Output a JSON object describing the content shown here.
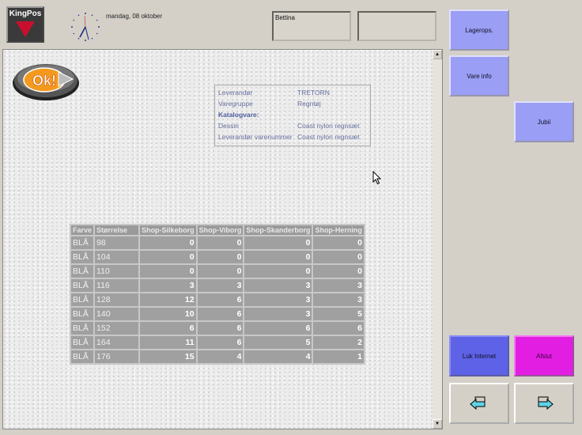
{
  "header": {
    "logo_text": "KingPos",
    "date": "mandag, 08 oktober",
    "user": "Bettina"
  },
  "info": {
    "rows": [
      {
        "key": "Leverandør",
        "value": "TRETORN"
      },
      {
        "key": "Varegruppe",
        "value": "Regntøj"
      },
      {
        "key": "Katalogvare:",
        "value": ""
      },
      {
        "key": "Dessin",
        "value": "Coast nylon regnsæt"
      },
      {
        "key": "Leverandør varenummer",
        "value": "Coast nylon regnsæt"
      }
    ]
  },
  "stock": {
    "headers": [
      "Farve",
      "Størrelse",
      "Shop-Silkeborg",
      "Shop-Viborg",
      "Shop-Skanderborg",
      "Shop-Herning"
    ],
    "rows": [
      [
        "BLÅ",
        "98",
        "0",
        "0",
        "0",
        "0"
      ],
      [
        "BLÅ",
        "104",
        "0",
        "0",
        "0",
        "0"
      ],
      [
        "BLÅ",
        "110",
        "0",
        "0",
        "0",
        "0"
      ],
      [
        "BLÅ",
        "116",
        "3",
        "3",
        "3",
        "3"
      ],
      [
        "BLÅ",
        "128",
        "12",
        "6",
        "3",
        "3"
      ],
      [
        "BLÅ",
        "140",
        "10",
        "6",
        "3",
        "5"
      ],
      [
        "BLÅ",
        "152",
        "6",
        "6",
        "6",
        "6"
      ],
      [
        "BLÅ",
        "164",
        "11",
        "6",
        "5",
        "2"
      ],
      [
        "BLÅ",
        "176",
        "15",
        "4",
        "4",
        "1"
      ]
    ]
  },
  "sidebar": {
    "lagerops": "Lagerops.",
    "vare_info": "Vare info",
    "jubii": "Jubii",
    "luk_internet": "Luk Internet",
    "afslut": "Afslut"
  },
  "ok_label": "Ok!",
  "icons": {
    "logo": "kingpos-logo-icon",
    "clock": "clock-icon",
    "back": "back-arrow-icon",
    "forward": "forward-arrow-icon",
    "cursor": "mouse-cursor-icon"
  },
  "colors": {
    "button_blue": "#9a9ef5",
    "luk_blue": "#5d62e6",
    "afslut_magenta": "#e31ee3"
  }
}
